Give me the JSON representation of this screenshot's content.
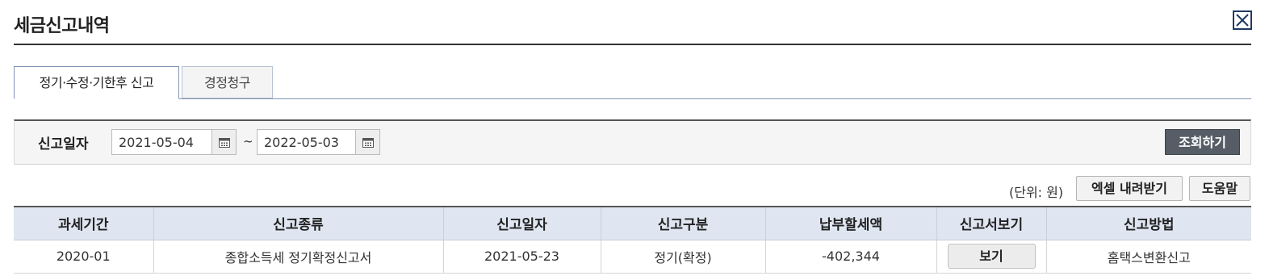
{
  "header": {
    "title": "세금신고내역"
  },
  "tabs": [
    {
      "label": "정기·수정·기한후 신고",
      "active": true
    },
    {
      "label": "경정청구",
      "active": false
    }
  ],
  "search": {
    "label": "신고일자",
    "start_date": "2021-05-04",
    "end_date": "2022-05-03",
    "separator": "~",
    "button_label": "조회하기"
  },
  "toolbar": {
    "unit": "(단위: 원)",
    "excel_label": "엑셀 내려받기",
    "help_label": "도움말"
  },
  "table": {
    "columns": [
      "과세기간",
      "신고종류",
      "신고일자",
      "신고구분",
      "납부할세액",
      "신고서보기",
      "신고방법"
    ],
    "rows": [
      {
        "period": "2020-01",
        "type": "종합소득세 정기확정신고서",
        "date": "2021-05-23",
        "category": "정기(확정)",
        "tax_amount": "-402,344",
        "view_label": "보기",
        "method": "홈택스변환신고"
      }
    ]
  },
  "colors": {
    "header_bg": "#dfe6f1",
    "tab_border": "#7f93b4",
    "search_button": "#565d66",
    "close_icon": "#1f3a64"
  },
  "icons": {
    "close": "close-icon",
    "calendar": "calendar-icon"
  }
}
